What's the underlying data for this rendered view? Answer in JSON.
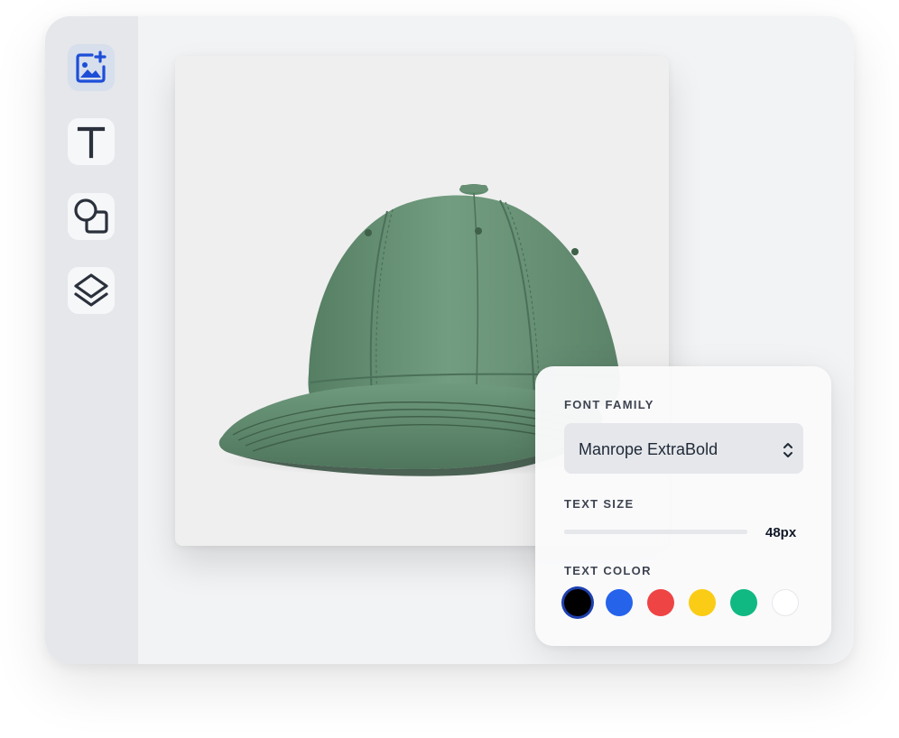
{
  "toolbar": {
    "items": [
      {
        "name": "add-image",
        "icon": "image-plus-icon",
        "active": true
      },
      {
        "name": "text",
        "icon": "text-icon",
        "active": false
      },
      {
        "name": "shapes",
        "icon": "shapes-icon",
        "active": false
      },
      {
        "name": "layers",
        "icon": "layers-icon",
        "active": false
      }
    ]
  },
  "canvas": {
    "product": "green baseball cap",
    "cap_color": "#6a9478"
  },
  "panel": {
    "font_family_label": "FONT FAMILY",
    "font_family_value": "Manrope ExtraBold",
    "text_size_label": "TEXT SIZE",
    "text_size_value": "48px",
    "text_color_label": "TEXT COLOR",
    "colors": [
      "#000000",
      "#2563eb",
      "#ef4444",
      "#facc15",
      "#10b981",
      "#ffffff"
    ],
    "selected_color": "#000000"
  }
}
